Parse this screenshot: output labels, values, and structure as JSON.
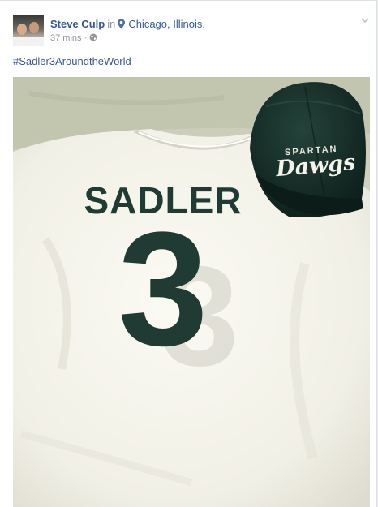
{
  "post": {
    "author_name": "Steve Culp",
    "in_word": "in",
    "location": "Chicago, Illinois.",
    "time": "37 mins",
    "separator": "·",
    "hashtag": "#Sadler3AroundtheWorld"
  },
  "photo": {
    "jersey_name": "SADLER",
    "jersey_number": "3",
    "hat_word_top": "SPARTAN",
    "hat_word_main": "Dawgs"
  },
  "icons": {
    "location": "map-pin-icon",
    "privacy": "globe-icon",
    "menu": "chevron-down-icon"
  },
  "colors": {
    "link": "#365899",
    "muted": "#90949c",
    "jersey_print": "#1f3b33",
    "hat": "#16302a"
  }
}
